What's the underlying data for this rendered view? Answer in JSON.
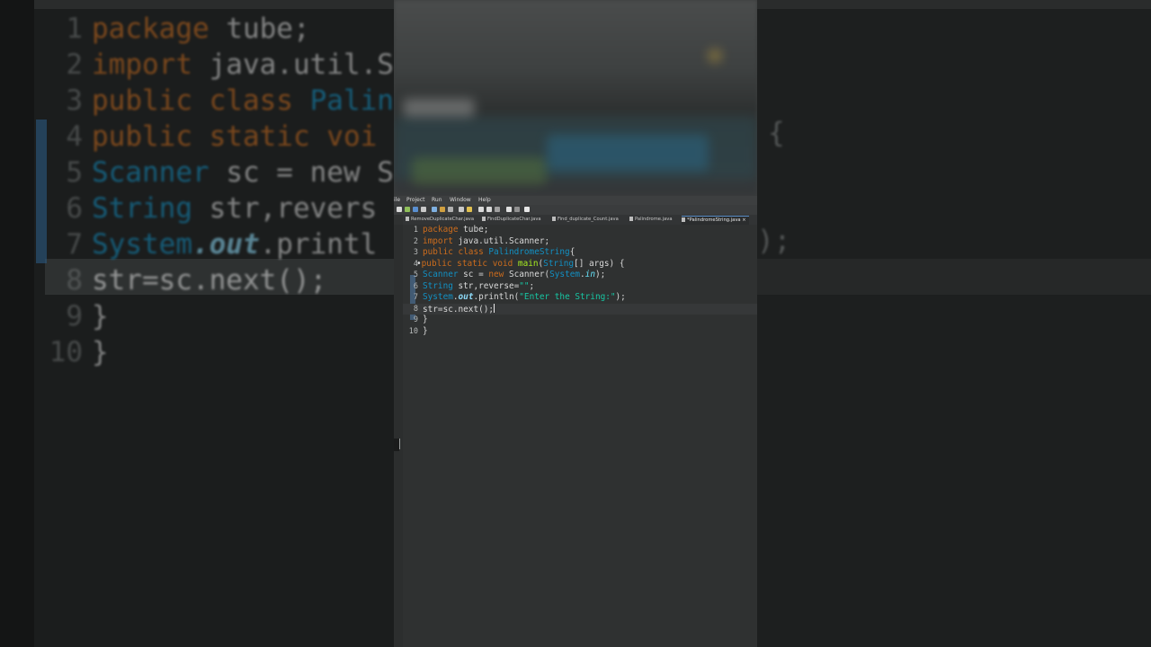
{
  "menu": [
    "Project",
    "Run",
    "Window",
    "Help"
  ],
  "tabs": [
    {
      "label": "RemoveDuplicateChar.java",
      "active": false
    },
    {
      "label": "FindDuplicateChar.java",
      "active": false
    },
    {
      "label": "Find_duplicate_Count.java",
      "active": false
    },
    {
      "label": "Palindrome.java",
      "active": false
    },
    {
      "label": "*PalindromeString.java",
      "active": true
    }
  ],
  "tab_close": "×",
  "code": {
    "line_numbers": [
      "1",
      "2",
      "3",
      "4",
      "5",
      "6",
      "7",
      "8",
      "9",
      "10"
    ],
    "l1_kw": "package",
    "l1_rest": " tube;",
    "l2_kw": "import",
    "l2_rest": " java.util.Scanner;",
    "l3_kw1": "public",
    "l3_kw2": " class ",
    "l3_type": "PalindromeString",
    "l3_rest": "{",
    "l4_kw1": "public",
    "l4_kw2": " static",
    "l4_kw3": " void",
    "l4_fn": " main",
    "l4_p1": "(",
    "l4_type": "String",
    "l4_rest": "[] args) {",
    "l5_type": "Scanner",
    "l5_a": " sc = ",
    "l5_kw": "new",
    "l5_b": " Scanner(",
    "l5_type2": "System",
    "l5_c": ".",
    "l5_fld": "in",
    "l5_d": ");",
    "l6_type": "String",
    "l6_a": " str,reverse=",
    "l6_str": "\"\"",
    "l6_b": ";",
    "l7_type": "System",
    "l7_a": ".",
    "l7_out": "out",
    "l7_b": ".println(",
    "l7_str": "\"Enter the String:\"",
    "l7_c": ");",
    "l8": "str=sc.next();",
    "l9": "}",
    "l10": "}"
  },
  "bg_big": {
    "n1": "1",
    "l1_kw": "package",
    "l1_rest": " tube;",
    "n2": "2",
    "l2_kw": "import",
    "l2_rest": " java.util.S",
    "n3": "3",
    "l3_kw": "public class",
    "l3_rest": " Palin",
    "n4": "4",
    "l4_kw": "public static",
    "l4_rest": " voi",
    "n5": "5",
    "l5_type": "Scanner",
    "l5_rest": " sc = new S",
    "n6": "6",
    "l6_type": "String",
    "l6_rest": " str,revers",
    "n7": "7",
    "l7_type": "System",
    "l7_out": ".out",
    "l7_rest": ".printl",
    "n8": "8",
    "l8": "str=sc.next();",
    "n9": "9",
    "l9": "}",
    "n10": "10",
    "l10": "}"
  },
  "bg_right": {
    "brace": "{",
    "semi": ");"
  },
  "colors": {
    "keyword": "#cc6c1d",
    "type": "#1290c3",
    "string": "#17c6a3",
    "function": "#a7ec21",
    "editor_bg": "#2f3131"
  }
}
